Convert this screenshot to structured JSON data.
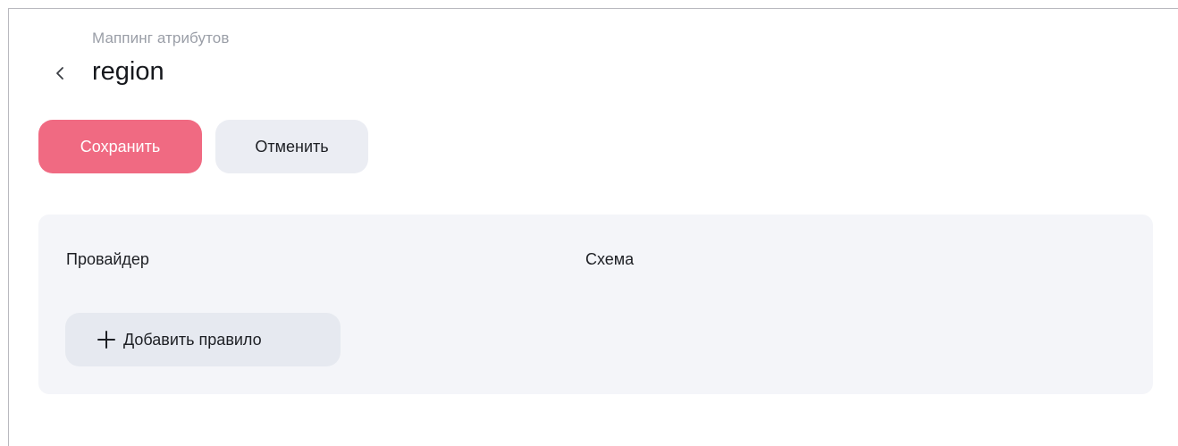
{
  "header": {
    "breadcrumb": "Маппинг атрибутов",
    "title": "region",
    "back_icon": "chevron-left-icon"
  },
  "toolbar": {
    "save_label": "Сохранить",
    "cancel_label": "Отменить"
  },
  "rules_panel": {
    "columns": [
      "Провайдер",
      "Схема"
    ],
    "add_rule_label": "Добавить правило",
    "add_icon": "plus-icon"
  },
  "colors": {
    "accent": "#f06a82",
    "secondary_button": "#ebedf3",
    "panel_background": "#f4f5f9",
    "muted_text": "#9a9ea7"
  }
}
